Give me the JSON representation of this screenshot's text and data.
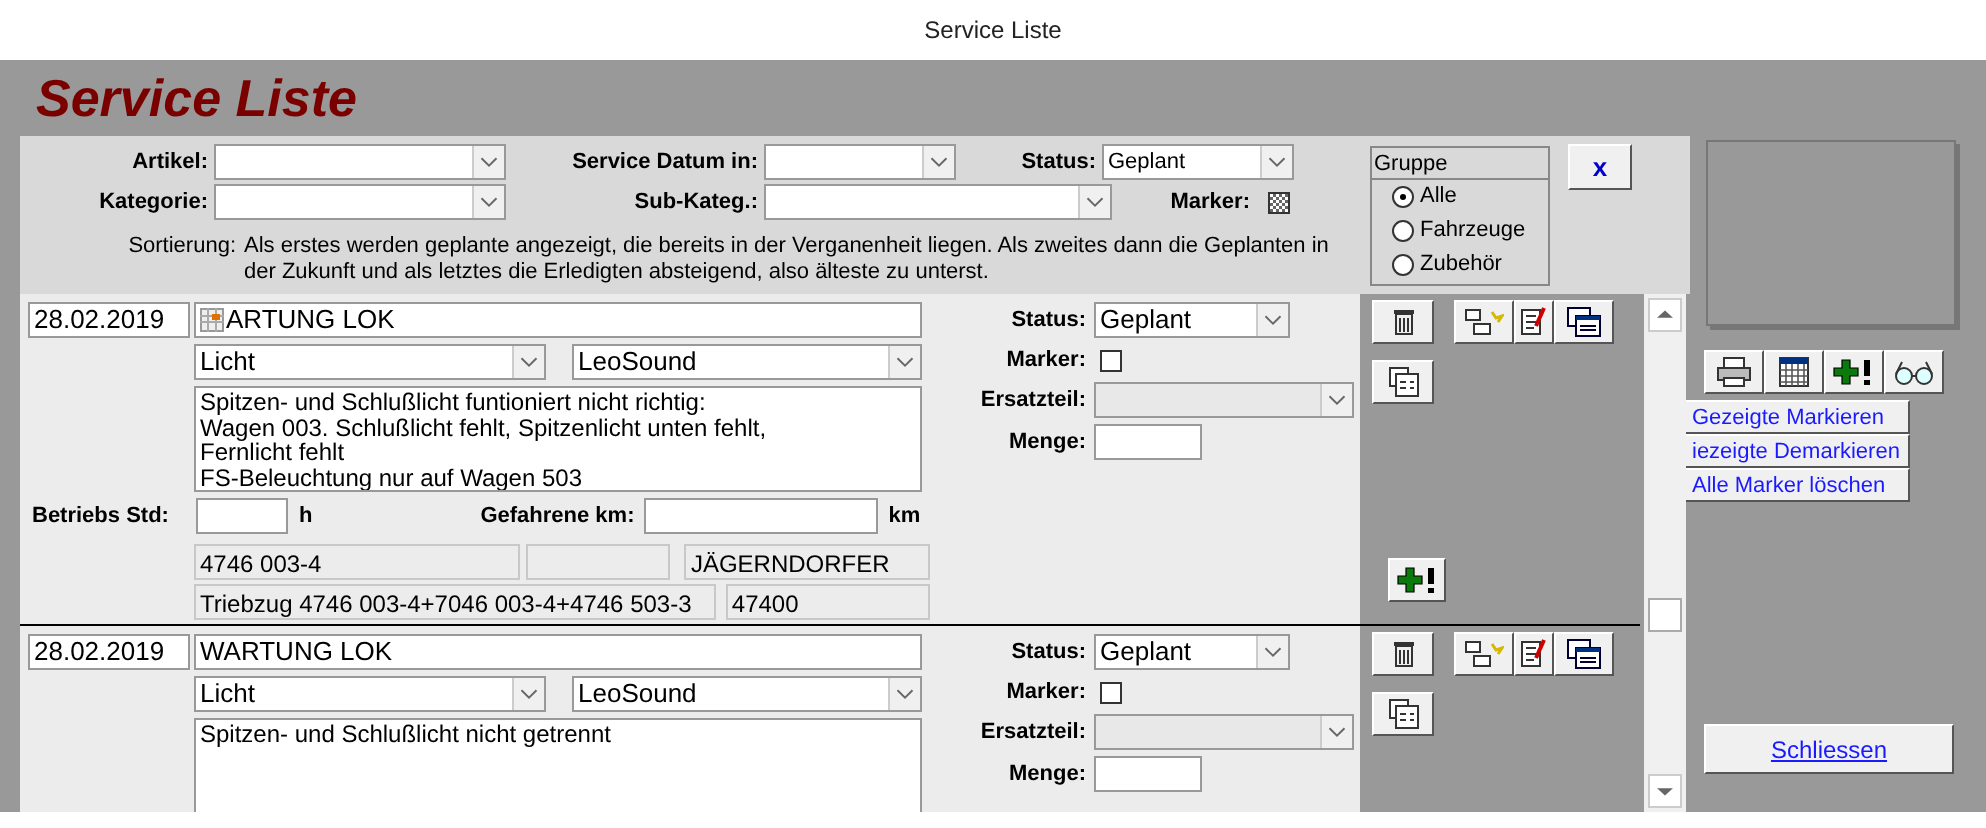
{
  "window": {
    "title": "Service Liste"
  },
  "app_title": "Service Liste",
  "filters": {
    "artikel_label": "Artikel:",
    "kategorie_label": "Kategorie:",
    "datum_label": "Service Datum in:",
    "subkat_label": "Sub-Kateg.:",
    "status_label": "Status:",
    "status_value": "Geplant",
    "marker_label": "Marker:",
    "marker_mixed": true,
    "sort_label": "Sortierung:",
    "sort_text": "Als erstes werden geplante angezeigt, die bereits in der Verganenheit liegen. Als zweites dann die Geplanten in der Zukunft und als letztes die Erledigten absteigend, also älteste zu unterst."
  },
  "group": {
    "title": "Gruppe",
    "options": [
      {
        "label": "Alle",
        "selected": true
      },
      {
        "label": "Fahrzeuge",
        "selected": false
      },
      {
        "label": "Zubehör",
        "selected": false
      }
    ]
  },
  "clear_button": "x",
  "records": [
    {
      "date": "28.02.2019",
      "title": "ARTUNG LOK",
      "calendar_icon": true,
      "category": "Licht",
      "subcategory": "LeoSound",
      "description": [
        "Spitzen- und Schlußlicht funtioniert nicht richtig:",
        "Wagen 003. Schlußlicht fehlt, Spitzenlicht unten fehlt,",
        "Fernlicht fehlt",
        "FS-Beleuchtung nur auf Wagen 503"
      ],
      "status_label": "Status:",
      "status": "Geplant",
      "marker_label": "Marker:",
      "marker_checked": false,
      "ersatzteil_label": "Ersatzteil:",
      "menge_label": "Menge:",
      "hours_label": "Betriebs Std:",
      "hours_unit": "h",
      "km_label": "Gefahrene km:",
      "km_unit": "km",
      "info": [
        "4746 003-4",
        "JÄGERNDORFER",
        "Triebzug 4746 003-4+7046 003-4+4746 503-3",
        "47400"
      ],
      "add_button": true
    },
    {
      "date": "28.02.2019",
      "title": "WARTUNG LOK",
      "calendar_icon": false,
      "category": "Licht",
      "subcategory": "LeoSound",
      "description": [
        "Spitzen- und Schlußlicht nicht getrennt"
      ],
      "status_label": "Status:",
      "status": "Geplant",
      "marker_label": "Marker:",
      "marker_checked": false,
      "ersatzteil_label": "Ersatzteil:",
      "menge_label": "Menge:"
    }
  ],
  "side_menu": [
    "Gezeigte Markieren",
    "iezeigte Demarkieren",
    "Alle Marker löschen"
  ],
  "close_button": "Schliessen"
}
